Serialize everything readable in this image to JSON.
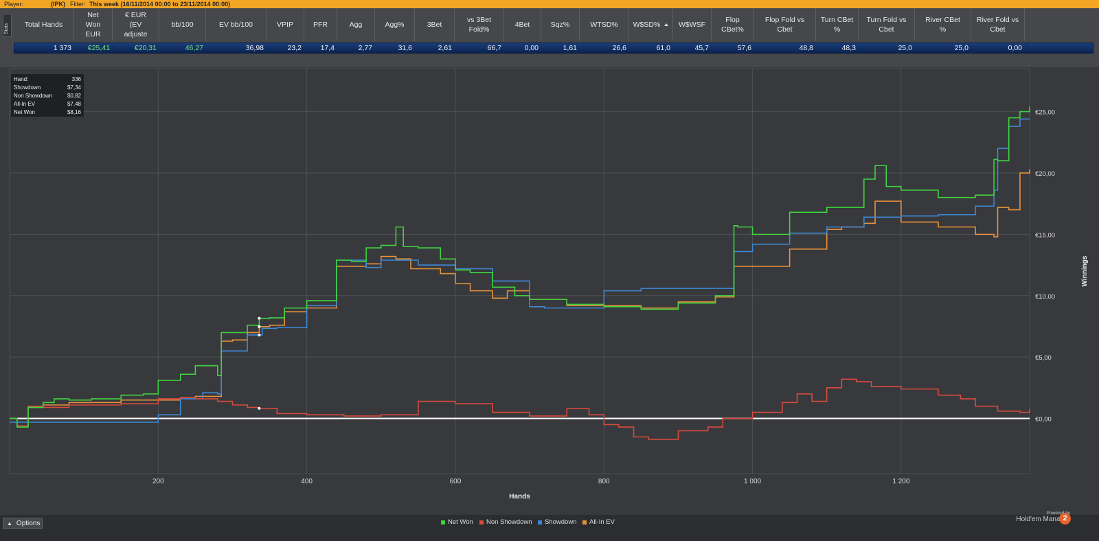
{
  "topbar": {
    "player_label": "Player:",
    "player_value": "(IPK)",
    "filter_label": "Filter:",
    "filter_value": "This week (16/11/2014 00:00 to 23/11/2014 00:00)"
  },
  "stats_tab_label": "Stats",
  "stats_table": {
    "headers": [
      "Total Hands",
      "Net\nWon\nEUR",
      "€ EUR\n(EV\nadjuste",
      "bb/100",
      "EV bb/100",
      "VPIP",
      "PFR",
      "Agg",
      "Agg%",
      "3Bet",
      "vs 3Bet\nFold%",
      "4Bet",
      "Sqz%",
      "WTSD%",
      "W$SD%",
      "W$WSF",
      "Flop\nCBet%",
      "Flop Fold vs\nCbet",
      "Turn CBet\n%",
      "Turn Fold vs\nCbet",
      "River CBet\n%",
      "River Fold vs\nCbet"
    ],
    "values": [
      "1 373",
      "€25,41",
      "€20,31",
      "46,27",
      "36,98",
      "23,2",
      "17,4",
      "2,77",
      "31,6",
      "2,61",
      "66,7",
      "0,00",
      "1,61",
      "26,6",
      "61,0",
      "45,7",
      "57,6",
      "48,8",
      "48,3",
      "25,0",
      "25,0",
      "0,00"
    ],
    "sorted_column": "W$SD%"
  },
  "hand_tooltip": {
    "rows": [
      {
        "label": "Hand:",
        "value": "336"
      },
      {
        "label": "Showdown",
        "value": "$7,34"
      },
      {
        "label": "Non Showdown",
        "value": "$0,82"
      },
      {
        "label": "All-In EV",
        "value": "$7,48"
      },
      {
        "label": "Net Won",
        "value": "$8,16"
      }
    ]
  },
  "chart_data": {
    "type": "line",
    "xlabel": "Hands",
    "ylabel": "Winnings",
    "x_ticks": [
      "200",
      "400",
      "600",
      "800",
      "1 000",
      "1 200"
    ],
    "y_ticks": [
      "€0,00",
      "€5,00",
      "€10,00",
      "€15,00",
      "€20,00",
      "€25,00"
    ],
    "xlim": [
      0,
      1373
    ],
    "ylim": [
      -4.5,
      28.5
    ],
    "grid": true,
    "legend_position": "bottom-center",
    "zero_line_color": "#ffffff",
    "series": [
      {
        "name": "Net Won",
        "color": "#3fd33f",
        "x": [
          0,
          10,
          25,
          45,
          60,
          80,
          110,
          150,
          180,
          200,
          230,
          250,
          280,
          285,
          300,
          320,
          336,
          350,
          370,
          400,
          430,
          440,
          460,
          480,
          500,
          520,
          530,
          550,
          580,
          600,
          620,
          650,
          680,
          700,
          750,
          800,
          850,
          900,
          950,
          975,
          980,
          1000,
          1050,
          1100,
          1150,
          1165,
          1180,
          1200,
          1250,
          1300,
          1325,
          1330,
          1345,
          1360,
          1373
        ],
        "y": [
          0.0,
          -0.7,
          0.9,
          1.3,
          1.6,
          1.5,
          1.6,
          1.9,
          2.0,
          3.1,
          3.6,
          4.3,
          3.5,
          7.0,
          7.0,
          7.6,
          8.16,
          8.2,
          9.0,
          9.6,
          9.6,
          12.9,
          12.8,
          13.9,
          14.1,
          15.6,
          14.0,
          13.9,
          13.0,
          12.1,
          11.9,
          10.7,
          10.0,
          9.7,
          9.3,
          9.1,
          8.9,
          9.4,
          10.0,
          15.7,
          15.6,
          15.0,
          16.8,
          17.2,
          19.5,
          20.6,
          18.9,
          18.6,
          18.0,
          18.2,
          21.1,
          21.0,
          24.5,
          25.0,
          25.4
        ]
      },
      {
        "name": "Non Showdown",
        "color": "#d94a3c",
        "x": [
          0,
          10,
          25,
          45,
          80,
          110,
          150,
          200,
          230,
          250,
          280,
          300,
          320,
          336,
          360,
          400,
          450,
          500,
          550,
          600,
          650,
          700,
          750,
          780,
          800,
          820,
          840,
          860,
          900,
          940,
          960,
          1000,
          1040,
          1060,
          1080,
          1100,
          1120,
          1140,
          1160,
          1200,
          1250,
          1280,
          1300,
          1330,
          1360,
          1373
        ],
        "y": [
          0.0,
          -0.6,
          1.0,
          0.9,
          1.1,
          1.1,
          1.2,
          1.6,
          1.7,
          1.6,
          1.4,
          1.1,
          0.9,
          0.82,
          0.4,
          0.3,
          0.2,
          0.3,
          1.4,
          1.2,
          0.5,
          0.2,
          0.8,
          0.3,
          -0.5,
          -0.7,
          -1.5,
          -1.7,
          -1.0,
          -0.7,
          0.0,
          0.5,
          1.3,
          2.0,
          1.4,
          2.5,
          3.2,
          3.0,
          2.6,
          2.4,
          1.9,
          1.6,
          1.0,
          0.6,
          0.5,
          0.8
        ]
      },
      {
        "name": "Showdown",
        "color": "#3d88d4",
        "x": [
          0,
          45,
          200,
          230,
          260,
          280,
          285,
          320,
          340,
          360,
          400,
          440,
          480,
          500,
          550,
          600,
          650,
          700,
          720,
          800,
          850,
          900,
          950,
          975,
          1000,
          1050,
          1100,
          1150,
          1200,
          1250,
          1300,
          1325,
          1330,
          1345,
          1360,
          1373
        ],
        "y": [
          -0.3,
          -0.3,
          0.3,
          1.6,
          2.1,
          2.0,
          5.5,
          6.8,
          7.34,
          7.4,
          9.2,
          12.9,
          12.3,
          12.9,
          12.5,
          12.2,
          11.2,
          9.1,
          9.0,
          10.4,
          10.6,
          10.6,
          10.6,
          13.6,
          14.2,
          15.1,
          15.6,
          16.4,
          16.5,
          16.6,
          17.3,
          18.6,
          22.0,
          23.8,
          24.4,
          24.4
        ]
      },
      {
        "name": "All-In EV",
        "color": "#e8923a",
        "x": [
          0,
          10,
          25,
          45,
          80,
          150,
          200,
          230,
          250,
          285,
          300,
          320,
          336,
          350,
          370,
          400,
          440,
          480,
          500,
          520,
          540,
          580,
          600,
          620,
          650,
          670,
          700,
          750,
          800,
          850,
          900,
          950,
          975,
          1000,
          1050,
          1100,
          1120,
          1150,
          1165,
          1200,
          1250,
          1300,
          1325,
          1330,
          1345,
          1360,
          1373
        ],
        "y": [
          0.0,
          -0.6,
          0.9,
          1.1,
          1.3,
          1.5,
          1.5,
          1.7,
          1.8,
          6.3,
          6.4,
          7.0,
          7.48,
          7.6,
          8.7,
          9.0,
          12.4,
          12.6,
          13.2,
          13.0,
          12.2,
          11.8,
          11.0,
          10.4,
          9.8,
          10.4,
          9.7,
          9.2,
          9.2,
          9.0,
          9.5,
          9.9,
          12.4,
          12.4,
          13.8,
          15.4,
          15.6,
          15.9,
          17.7,
          16.0,
          15.6,
          15.0,
          14.8,
          17.2,
          17.0,
          20.0,
          20.3
        ]
      }
    ]
  },
  "legend": [
    "Net Won",
    "Non Showdown",
    "Showdown",
    "All-In EV"
  ],
  "options_label": "Options",
  "brand": {
    "powered_by": "Powered by",
    "name": "Hold'em Manager",
    "logo_text": "2"
  }
}
